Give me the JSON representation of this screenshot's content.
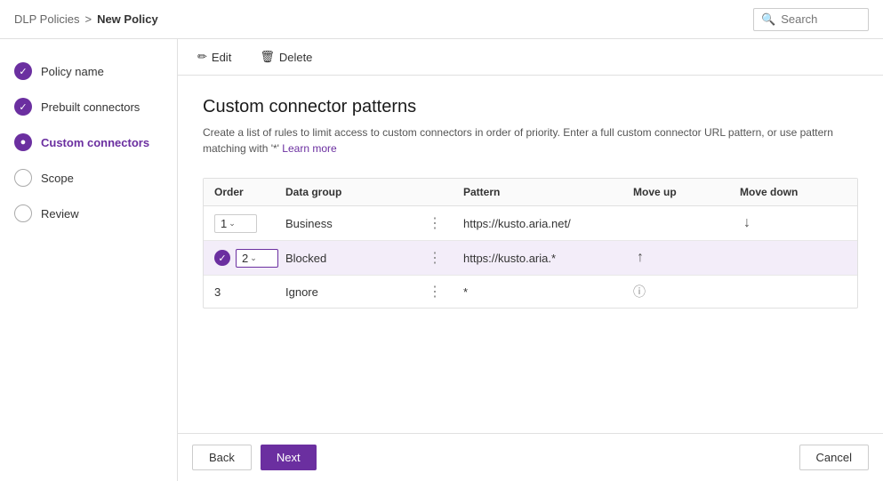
{
  "breadcrumb": {
    "parent": "DLP Policies",
    "separator": ">",
    "current": "New Policy"
  },
  "toolbar": {
    "edit_label": "Edit",
    "delete_label": "Delete",
    "search_placeholder": "Search"
  },
  "sidebar": {
    "items": [
      {
        "id": "policy-name",
        "label": "Policy name",
        "state": "completed"
      },
      {
        "id": "prebuilt-connectors",
        "label": "Prebuilt connectors",
        "state": "completed"
      },
      {
        "id": "custom-connectors",
        "label": "Custom connectors",
        "state": "active"
      },
      {
        "id": "scope",
        "label": "Scope",
        "state": "empty"
      },
      {
        "id": "review",
        "label": "Review",
        "state": "empty"
      }
    ]
  },
  "page": {
    "title": "Custom connector patterns",
    "description": "Create a list of rules to limit access to custom connectors in order of priority. Enter a full custom connector URL pattern, or use pattern matching with '*'",
    "learn_more": "Learn more"
  },
  "table": {
    "headers": {
      "order": "Order",
      "data_group": "Data group",
      "dots": "",
      "pattern": "Pattern",
      "move_up": "Move up",
      "move_down": "Move down"
    },
    "rows": [
      {
        "id": "row-1",
        "order": "1",
        "order_type": "select",
        "data_group": "Business",
        "pattern": "https://kusto.aria.net/",
        "move_up": false,
        "move_down": true,
        "selected": false,
        "has_check": false
      },
      {
        "id": "row-2",
        "order": "2",
        "order_type": "select",
        "data_group": "Blocked",
        "pattern": "https://kusto.aria.*",
        "move_up": true,
        "move_down": false,
        "selected": true,
        "has_check": true
      },
      {
        "id": "row-3",
        "order": "3",
        "order_type": "plain",
        "data_group": "Ignore",
        "pattern": "*",
        "move_up": false,
        "move_down": false,
        "selected": false,
        "has_check": false,
        "has_info": true
      }
    ]
  },
  "footer": {
    "back_label": "Back",
    "next_label": "Next",
    "cancel_label": "Cancel"
  },
  "icons": {
    "edit": "✏",
    "delete": "🗑",
    "search": "🔍",
    "check": "✓",
    "arrow_up": "↑",
    "arrow_down": "↓",
    "chevron_down": "⌄",
    "dots": "⋮",
    "info": "ⓘ"
  }
}
